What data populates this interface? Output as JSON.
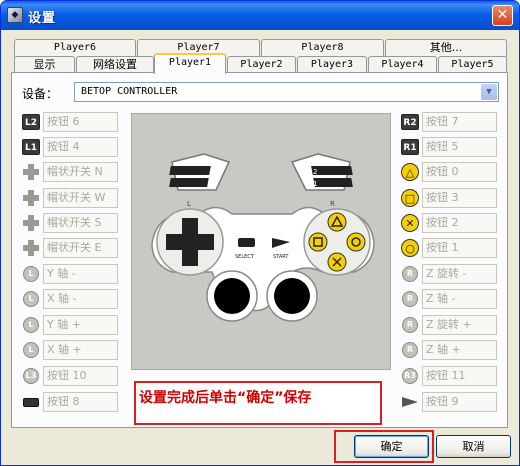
{
  "window": {
    "title": "设置",
    "icon": "gamepad-app-icon",
    "close_glyph": "✕"
  },
  "tabs_row_back": [
    {
      "label": "Player6"
    },
    {
      "label": "Player7"
    },
    {
      "label": "Player8"
    },
    {
      "label": "其他..."
    }
  ],
  "tabs_row_front": [
    {
      "label": "显示"
    },
    {
      "label": "网络设置"
    },
    {
      "label": "Player1",
      "active": true
    },
    {
      "label": "Player2"
    },
    {
      "label": "Player3"
    },
    {
      "label": "Player4"
    },
    {
      "label": "Player5"
    }
  ],
  "device": {
    "label": "设备：",
    "value": "BETOP CONTROLLER"
  },
  "left_mappings": [
    {
      "icon": "L2-trigger-icon",
      "icon_text": "L2",
      "value": "按钮 6"
    },
    {
      "icon": "L1-trigger-icon",
      "icon_text": "L1",
      "value": "按钮 4"
    },
    {
      "icon": "dpad-up-icon",
      "icon_text": "",
      "value": "帽状开关 N"
    },
    {
      "icon": "dpad-left-icon",
      "icon_text": "",
      "value": "帽状开关 W"
    },
    {
      "icon": "dpad-down-icon",
      "icon_text": "",
      "value": "帽状开关 S"
    },
    {
      "icon": "dpad-right-icon",
      "icon_text": "",
      "value": "帽状开关 E"
    },
    {
      "icon": "left-stick-up-icon",
      "icon_text": "L",
      "value": "Y 轴 -"
    },
    {
      "icon": "left-stick-left-icon",
      "icon_text": "L",
      "value": "X 轴 -"
    },
    {
      "icon": "left-stick-down-icon",
      "icon_text": "L",
      "value": "Y 轴 +"
    },
    {
      "icon": "left-stick-right-icon",
      "icon_text": "L",
      "value": "X 轴 +"
    },
    {
      "icon": "L3-stick-press-icon",
      "icon_text": "L3",
      "value": "按钮 10"
    },
    {
      "icon": "select-button-icon",
      "icon_text": "",
      "value": "按钮 8"
    }
  ],
  "right_mappings": [
    {
      "icon": "R2-trigger-icon",
      "icon_text": "R2",
      "value": "按钮 7"
    },
    {
      "icon": "R1-trigger-icon",
      "icon_text": "R1",
      "value": "按钮 5"
    },
    {
      "icon": "triangle-button-icon",
      "icon_text": "△",
      "value": "按钮 0"
    },
    {
      "icon": "square-button-icon",
      "icon_text": "□",
      "value": "按钮 3"
    },
    {
      "icon": "cross-button-icon",
      "icon_text": "✕",
      "value": "按钮 2"
    },
    {
      "icon": "circle-button-icon",
      "icon_text": "○",
      "value": "按钮 1"
    },
    {
      "icon": "right-stick-up-icon",
      "icon_text": "R",
      "value": "Z 旋转 -"
    },
    {
      "icon": "right-stick-left-icon",
      "icon_text": "R",
      "value": "Z 轴 -"
    },
    {
      "icon": "right-stick-down-icon",
      "icon_text": "R",
      "value": "Z 旋转 +"
    },
    {
      "icon": "right-stick-right-icon",
      "icon_text": "R",
      "value": "Z 轴 +"
    },
    {
      "icon": "R3-stick-press-icon",
      "icon_text": "R3",
      "value": "按钮 11"
    },
    {
      "icon": "start-button-icon",
      "icon_text": "",
      "value": "按钮 9"
    }
  ],
  "gamepad": {
    "l_label": "L",
    "r_label": "R",
    "trigger_top_label": "2",
    "trigger_bottom_label": "1",
    "select_label": "SELECT",
    "start_label": "START"
  },
  "annotation": {
    "text": "设置完成后单击“确定”保存",
    "color": "#d00000"
  },
  "buttons": {
    "ok_label": "确定",
    "cancel_label": "取消"
  },
  "colors": {
    "titlebar": "#0a5fe6",
    "accent_tab": "#ffc83c",
    "face_button": "#f4d000",
    "highlight_border": "#d72020"
  }
}
